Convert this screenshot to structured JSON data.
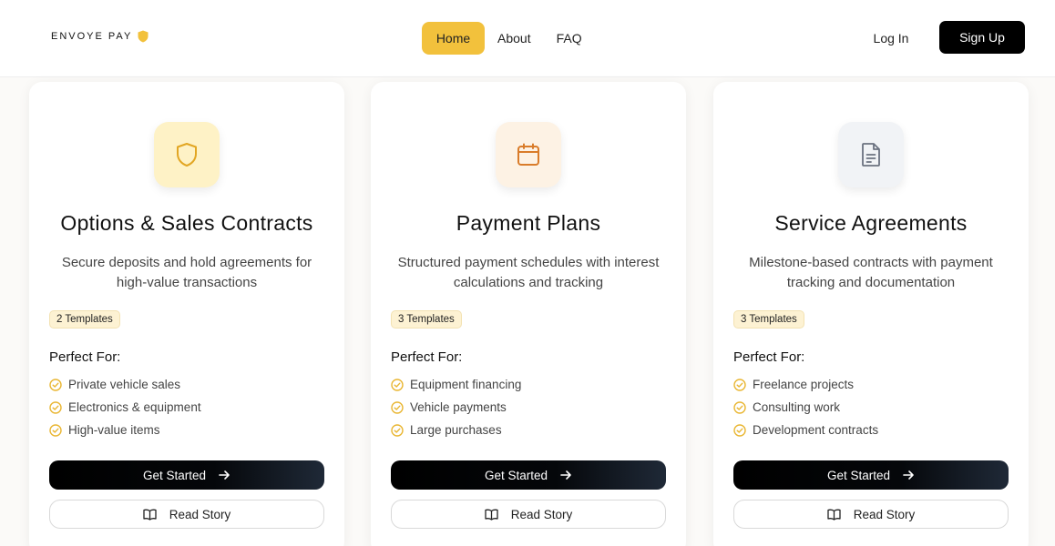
{
  "brand": {
    "name": "ENVOYE PAY",
    "accent": "#f2c13c"
  },
  "nav": {
    "items": [
      {
        "label": "Home",
        "active": true
      },
      {
        "label": "About",
        "active": false
      },
      {
        "label": "FAQ",
        "active": false
      }
    ],
    "login": "Log In",
    "signup": "Sign Up"
  },
  "cards": [
    {
      "icon": "shield-icon",
      "title": "Options & Sales Contracts",
      "description": "Secure deposits and hold agreements for high-value transactions",
      "badge": "2 Templates",
      "perfect_for_label": "Perfect For:",
      "features": [
        "Private vehicle sales",
        "Electronics & equipment",
        "High-value items"
      ],
      "primary_button": "Get Started",
      "secondary_button": "Read Story"
    },
    {
      "icon": "calendar-icon",
      "title": "Payment Plans",
      "description": "Structured payment schedules with interest calculations and tracking",
      "badge": "3 Templates",
      "perfect_for_label": "Perfect For:",
      "features": [
        "Equipment financing",
        "Vehicle payments",
        "Large purchases"
      ],
      "primary_button": "Get Started",
      "secondary_button": "Read Story"
    },
    {
      "icon": "document-icon",
      "title": "Service Agreements",
      "description": "Milestone-based contracts with payment tracking and documentation",
      "badge": "3 Templates",
      "perfect_for_label": "Perfect For:",
      "features": [
        "Freelance projects",
        "Consulting work",
        "Development contracts"
      ],
      "primary_button": "Get Started",
      "secondary_button": "Read Story"
    }
  ]
}
